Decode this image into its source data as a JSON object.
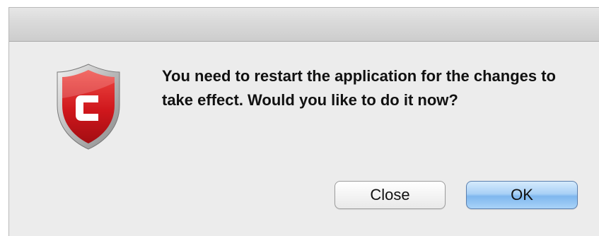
{
  "dialog": {
    "icon": "comodo-shield-icon",
    "message": "You need to restart the application for the changes to take effect. Would you like to do it now?",
    "buttons": {
      "close_label": "Close",
      "ok_label": "OK"
    }
  },
  "colors": {
    "shield_red": "#d11a1f",
    "shield_silver": "#c9c9c9",
    "ok_button_blue": "#8dc1f2",
    "dialog_background": "#ececec"
  }
}
